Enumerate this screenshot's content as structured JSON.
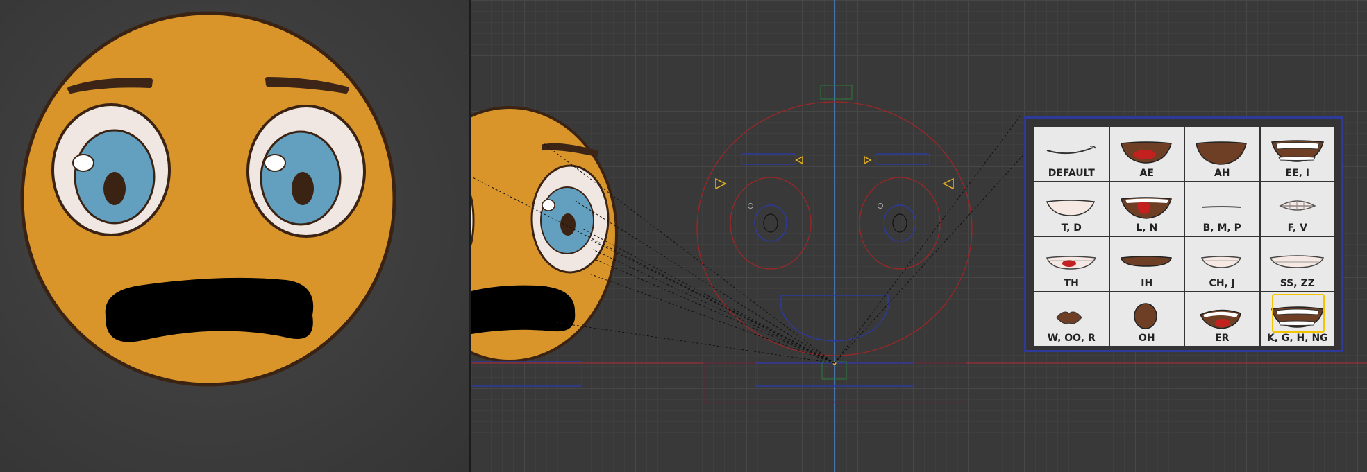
{
  "colors": {
    "face": "#d9952a",
    "outline": "#3b2314",
    "eye_white": "#f1e7e2",
    "iris": "#639fbf",
    "brow": "#3c2516",
    "rig_red": "#9c2727",
    "rig_blue": "#2d3a9a",
    "axis_blue": "#4a86d6",
    "handle_yellow": "#e7b21f",
    "selection": "#f2c500"
  },
  "visemes": [
    {
      "label": "DEFAULT",
      "shape": "line-smile"
    },
    {
      "label": "AE",
      "shape": "open-tongue-wide"
    },
    {
      "label": "AH",
      "shape": "open-dark"
    },
    {
      "label": "EE, I",
      "shape": "teeth-wide"
    },
    {
      "label": "T, D",
      "shape": "open-smile"
    },
    {
      "label": "L, N",
      "shape": "tongue-up"
    },
    {
      "label": "B, M, P",
      "shape": "closed-line"
    },
    {
      "label": "F, V",
      "shape": "teeth-lip"
    },
    {
      "label": "TH",
      "shape": "teeth-tongue"
    },
    {
      "label": "IH",
      "shape": "flat-open"
    },
    {
      "label": "CH, J",
      "shape": "small-teeth"
    },
    {
      "label": "SS, ZZ",
      "shape": "teeth-grin"
    },
    {
      "label": "W, OO, R",
      "shape": "pucker"
    },
    {
      "label": "OH",
      "shape": "oval"
    },
    {
      "label": "ER",
      "shape": "tongue-round"
    },
    {
      "label": "K, G, H, NG",
      "shape": "wide-teeth-open",
      "selected": true
    }
  ]
}
